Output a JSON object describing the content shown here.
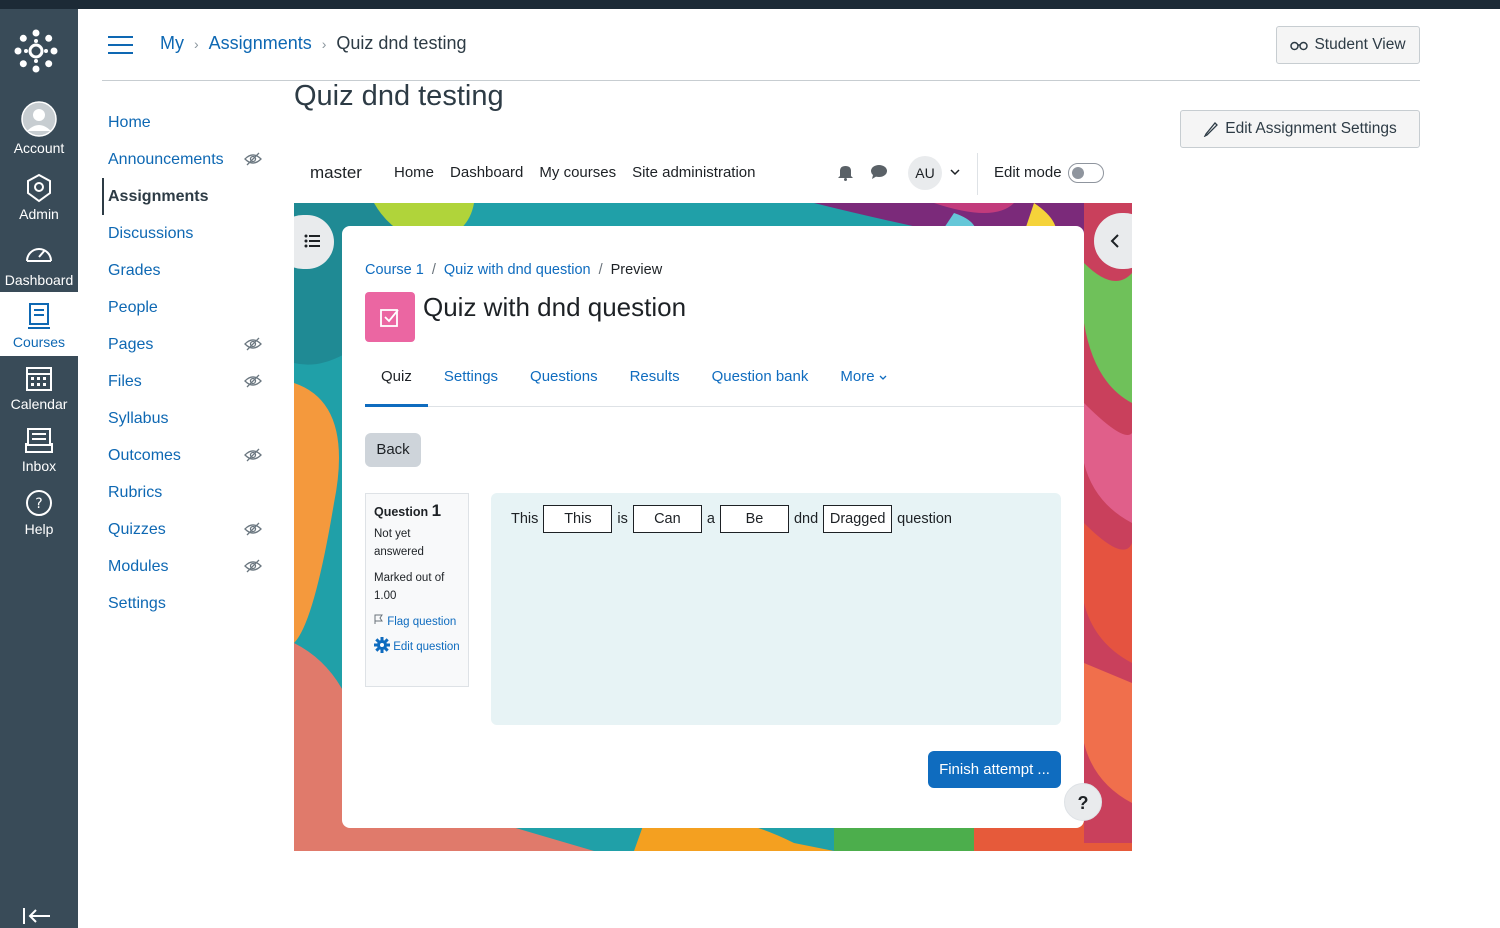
{
  "global_nav": {
    "items": [
      {
        "label": "Account",
        "icon": "account-icon"
      },
      {
        "label": "Admin",
        "icon": "admin-icon"
      },
      {
        "label": "Dashboard",
        "icon": "dashboard-icon"
      },
      {
        "label": "Courses",
        "icon": "courses-icon"
      },
      {
        "label": "Calendar",
        "icon": "calendar-icon"
      },
      {
        "label": "Inbox",
        "icon": "inbox-icon"
      },
      {
        "label": "Help",
        "icon": "help-icon"
      }
    ],
    "active": "Courses",
    "bg_color": "#394b58"
  },
  "breadcrumbs": [
    "My",
    "Assignments",
    "Quiz dnd testing"
  ],
  "header": {
    "student_view_label": "Student View",
    "edit_settings_label": "Edit Assignment Settings"
  },
  "page_title": "Quiz dnd testing",
  "course_nav": {
    "items": [
      {
        "label": "Home",
        "hidden": false
      },
      {
        "label": "Announcements",
        "hidden": true
      },
      {
        "label": "Assignments",
        "hidden": false,
        "active": true
      },
      {
        "label": "Discussions",
        "hidden": false
      },
      {
        "label": "Grades",
        "hidden": false
      },
      {
        "label": "People",
        "hidden": false
      },
      {
        "label": "Pages",
        "hidden": true
      },
      {
        "label": "Files",
        "hidden": true
      },
      {
        "label": "Syllabus",
        "hidden": false
      },
      {
        "label": "Outcomes",
        "hidden": true
      },
      {
        "label": "Rubrics",
        "hidden": false
      },
      {
        "label": "Quizzes",
        "hidden": true
      },
      {
        "label": "Modules",
        "hidden": true
      },
      {
        "label": "Settings",
        "hidden": false
      }
    ]
  },
  "moodle": {
    "brand": "master",
    "nav_links": [
      "Home",
      "Dashboard",
      "My courses",
      "Site administration"
    ],
    "avatar_initials": "AU",
    "edit_mode_label": "Edit mode",
    "edit_mode_on": false,
    "breadcrumb": [
      "Course 1",
      "Quiz with dnd question",
      "Preview"
    ],
    "quiz_title": "Quiz with dnd question",
    "tabs": [
      "Quiz",
      "Settings",
      "Questions",
      "Results",
      "Question bank",
      "More"
    ],
    "active_tab": "Quiz",
    "back_label": "Back",
    "question_info": {
      "question_label": "Question",
      "number": "1",
      "state": "Not yet answered",
      "marked": "Marked out of 1.00",
      "flag_label": "Flag question",
      "edit_label": "Edit question"
    },
    "question_text": [
      "This",
      "is",
      "a",
      "dnd",
      "question"
    ],
    "drop_answers": [
      "This",
      "Can",
      "Be",
      "Dragged"
    ],
    "finish_label": "Finish attempt ...",
    "help_label": "?",
    "accent_color": "#0f6cbf",
    "quiz_icon_color": "#eb66a2"
  }
}
